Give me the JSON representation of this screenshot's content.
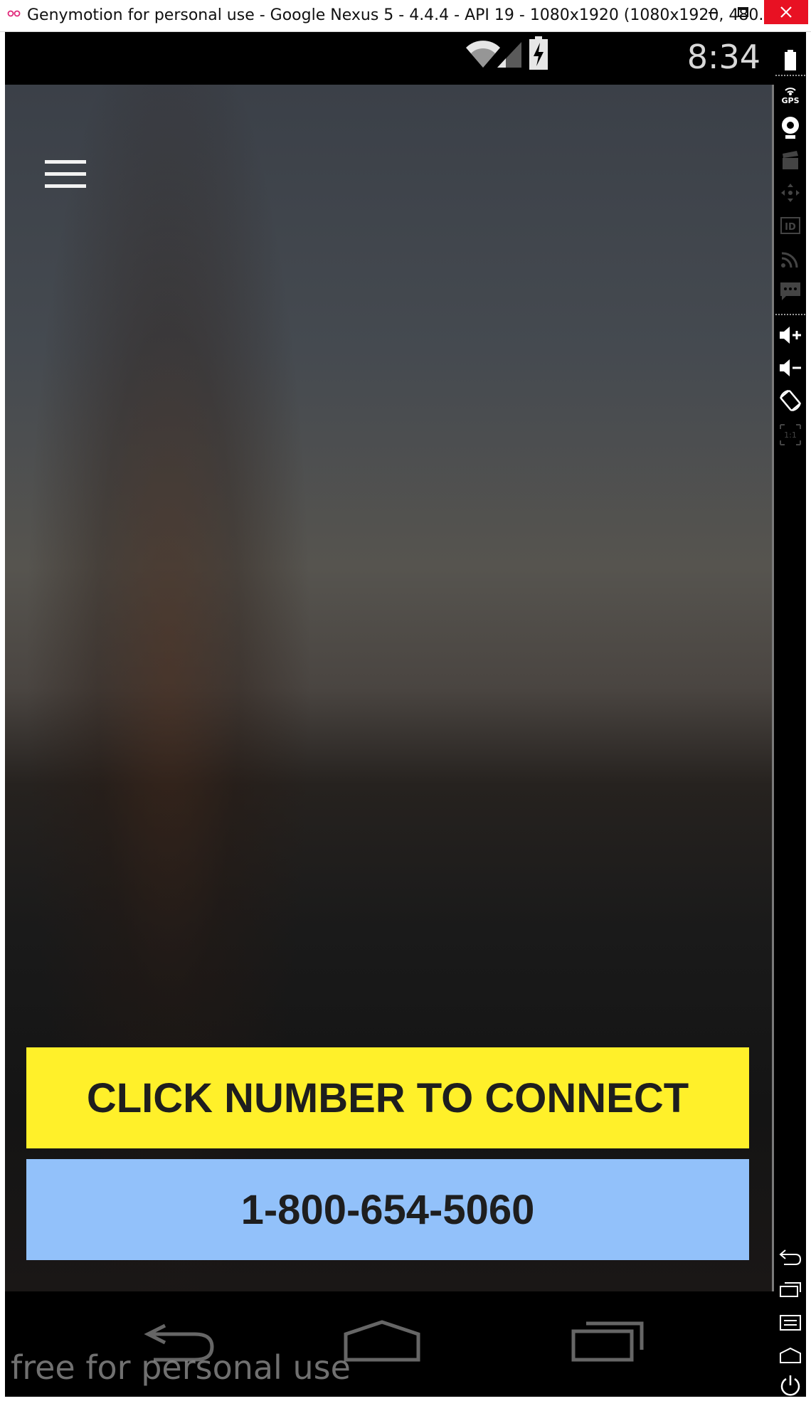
{
  "window": {
    "title": "Genymotion for personal use - Google Nexus 5 - 4.4.4 - API 19 - 1080x1920 (1080x1920, 480...",
    "close_color": "#e81123"
  },
  "statusbar": {
    "time": "8:34",
    "icons": [
      "wifi-icon",
      "signal-icon",
      "battery-charging-icon"
    ]
  },
  "app": {
    "menu_icon": "hamburger-menu-icon",
    "cta_text": "CLICK NUMBER TO CONNECT",
    "phone_number": "1-800-654-5060",
    "colors": {
      "cta_bg": "#fff02a",
      "phone_bg": "#92c1fa",
      "text": "#1e1e1e"
    }
  },
  "navbar": {
    "buttons": [
      "back-icon",
      "home-icon",
      "recent-apps-icon"
    ]
  },
  "watermark": "free for personal use",
  "side_toolbar": {
    "tools": [
      {
        "name": "battery-icon"
      },
      {
        "name": "gps-icon",
        "label": "GPS"
      },
      {
        "name": "webcam-icon"
      },
      {
        "name": "screencast-icon"
      },
      {
        "name": "remote-control-icon"
      },
      {
        "name": "device-id-icon",
        "label": "ID"
      },
      {
        "name": "network-icon"
      },
      {
        "name": "sms-icon"
      },
      {
        "name": "volume-up-icon"
      },
      {
        "name": "volume-down-icon"
      },
      {
        "name": "rotate-icon"
      },
      {
        "name": "pixel-perfect-icon",
        "label": "1:1"
      },
      {
        "name": "back-icon"
      },
      {
        "name": "recent-apps-icon"
      },
      {
        "name": "menu-icon"
      },
      {
        "name": "home-icon"
      },
      {
        "name": "power-icon"
      }
    ]
  }
}
